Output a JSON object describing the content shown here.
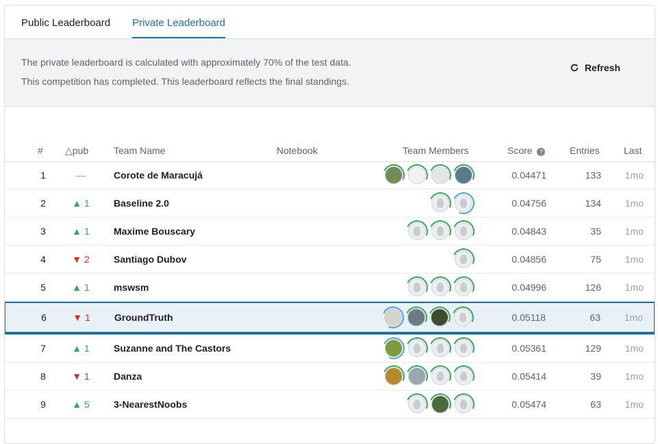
{
  "tabs": [
    {
      "label": "Public Leaderboard",
      "active": false
    },
    {
      "label": "Private Leaderboard",
      "active": true
    }
  ],
  "notice": {
    "line1": "The private leaderboard is calculated with approximately 70% of the test data.",
    "line2": "This competition has completed. This leaderboard reflects the final standings."
  },
  "refresh_label": "Refresh",
  "columns": {
    "rank": "#",
    "delta": "△pub",
    "team": "Team Name",
    "notebook": "Notebook",
    "members": "Team Members",
    "score": "Score",
    "entries": "Entries",
    "last": "Last"
  },
  "rows": [
    {
      "rank": "1",
      "delta": "—",
      "team": "Corote de Maracujá",
      "score": "0.04471",
      "entries": "133",
      "last": "1mo"
    },
    {
      "rank": "2",
      "delta": "▲ 1",
      "team": "Baseline 2.0",
      "score": "0.04756",
      "entries": "134",
      "last": "1mo"
    },
    {
      "rank": "3",
      "delta": "▲ 1",
      "team": "Maxime Bouscary",
      "score": "0.04843",
      "entries": "35",
      "last": "1mo"
    },
    {
      "rank": "4",
      "delta": "▼ 2",
      "team": "Santiago Dubov",
      "score": "0.04856",
      "entries": "75",
      "last": "1mo"
    },
    {
      "rank": "5",
      "delta": "▲ 1",
      "team": "mswsm",
      "score": "0.04996",
      "entries": "126",
      "last": "1mo"
    },
    {
      "rank": "6",
      "delta": "▼ 1",
      "team": "GroundTruth",
      "score": "0.05118",
      "entries": "63",
      "last": "1mo"
    },
    {
      "rank": "7",
      "delta": "▲ 1",
      "team": "Suzanne and The Castors",
      "score": "0.05361",
      "entries": "129",
      "last": "1mo"
    },
    {
      "rank": "8",
      "delta": "▼ 1",
      "team": "Danza",
      "score": "0.05414",
      "entries": "39",
      "last": "1mo"
    },
    {
      "rank": "9",
      "delta": "▲ 5",
      "team": "3-NearestNoobs",
      "score": "0.05474",
      "entries": "63",
      "last": "1mo"
    }
  ],
  "colors": {
    "accent": "#1a73a7",
    "up": "#34a853",
    "down": "#d93025"
  }
}
